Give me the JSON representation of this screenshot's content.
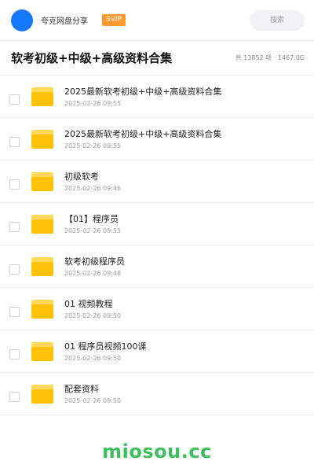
{
  "header": {
    "avatar_color": "#1677ff",
    "user_name": "夸克网盘分享",
    "badge": "SVIP",
    "search_placeholder": "搜索"
  },
  "title_row": {
    "title": "软考初级+中级+高级资料合集",
    "summary": "共 13852 项 · 1467.0G"
  },
  "files": [
    {
      "name": "2025最新软考初级+中级+高级资料合集",
      "date": "2025-02-26 09:55",
      "icon": "folder-icon"
    },
    {
      "name": "2025最新软考初级+中级+高级资料合集",
      "date": "2025-02-26 09:55",
      "icon": "folder-icon"
    },
    {
      "name": "初级软考",
      "date": "2025-02-26 09:46",
      "icon": "folder-icon"
    },
    {
      "name": "【01】程序员",
      "date": "2025-02-26 09:55",
      "icon": "folder-icon"
    },
    {
      "name": "软考初级程序员",
      "date": "2025-02-26 09:48",
      "icon": "folder-icon"
    },
    {
      "name": "01 视频教程",
      "date": "2025-02-26 09:50",
      "icon": "folder-icon"
    },
    {
      "name": "01 程序员视频100课",
      "date": "2025-02-26 09:50",
      "icon": "folder-icon"
    },
    {
      "name": "配套资料",
      "date": "2025-02-26 09:50",
      "icon": "folder-icon"
    }
  ],
  "watermark": "miosou.cc",
  "colors": {
    "accent": "#1677ff",
    "badge": "#ff9a2e",
    "folder": "#ffc107",
    "watermark": "#3cbf5c"
  }
}
